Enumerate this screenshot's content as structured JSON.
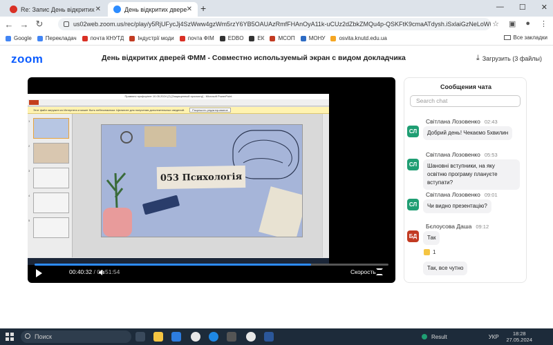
{
  "browser": {
    "tabs": [
      {
        "label": "Re: Запис День відкритих двер",
        "active": false
      },
      {
        "label": "День відкритих дверей ФММ",
        "active": true
      }
    ],
    "url": "us02web.zoom.us/rec/play/y5RjUFycJj4SzWww4gzWm5rzY6YB5OAUAzRmfFHAnOyA11k-uCUz2dZbkZMQu4p-QSKFtK9cmaATdysh.iSxlaiGzNeLoWINL?canPlayFromShare...",
    "bookmarks": [
      "Google",
      "Перекладач",
      "почта КНУТД",
      "Індустрії моди",
      "почта ФІМ",
      "EDBO",
      "ЕК",
      "МСОП",
      "МОНУ",
      "osvita.knutd.edu.ua"
    ],
    "bookmarks_all": "Все закладки"
  },
  "zoom": {
    "logo": "zoom",
    "meeting_title": "День відкритих дверей ФММ - Совместно используемый экран с видом докладчика",
    "download_label": "Загрузить (3 файлы)"
  },
  "ppt": {
    "window_title": "Правничі профорієнт 10.05.2024 (2) [Защищенный просмотр] - Microsoft PowerPoint",
    "warning": "Этот файл загружен из Интернета и может быть небезопасным. Щелкните для получения дополнительных сведений.",
    "enable_editing": "Разрешить редактирование",
    "slide_title": "053 Психологія",
    "status": "Слайд 1 из 11"
  },
  "player": {
    "current_time": "00:40:32",
    "duration": "00:51:54",
    "progress_fraction": 0.781,
    "speed_label": "Скорость"
  },
  "chat": {
    "title": "Сообщения чата",
    "search_placeholder": "Search chat",
    "messages": [
      {
        "initials": "СЛ",
        "name": "Світлана Лозовенко",
        "time": "02:43",
        "text": "Добрий день! Чекаємо 5хвилин"
      },
      {
        "initials": "СЛ",
        "name": "Світлана Лозовенко",
        "time": "05:53",
        "text": "Шановні вступники, на яку освітню програму плануєте вступати?"
      },
      {
        "initials": "СЛ",
        "name": "Світлана Лозовенко",
        "time": "09:01",
        "text": "Чи видно презентацію?"
      },
      {
        "initials": "БД",
        "name": "Бєлоусова Даша",
        "time": "09:12",
        "text": "Так"
      }
    ],
    "reaction_count": "1",
    "extra_message": "Так, все чутно",
    "colors": {
      "sl": "#1f9e73",
      "bd": "#c23b22"
    }
  },
  "taskbar": {
    "search": "Поиск",
    "tray_result": "Result",
    "lang": "УКР",
    "time": "18:28",
    "date": "27.05.2024"
  }
}
